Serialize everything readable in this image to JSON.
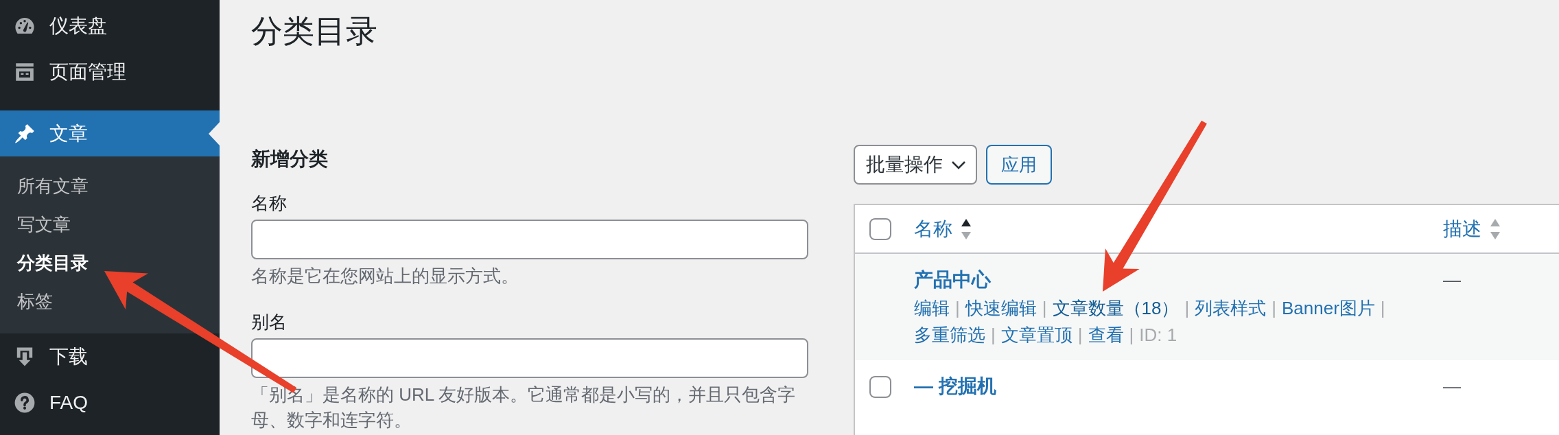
{
  "sidebar": {
    "menu": [
      {
        "kind": "item",
        "label": "仪表盘",
        "selected": false
      },
      {
        "kind": "item",
        "label": "页面管理",
        "selected": false
      },
      {
        "kind": "separator"
      },
      {
        "kind": "item",
        "label": "文章",
        "selected": true,
        "children": [
          {
            "label": "所有文章",
            "selected": false
          },
          {
            "label": "写文章",
            "selected": false
          },
          {
            "label": "分类目录",
            "selected": true
          },
          {
            "label": "标签",
            "selected": false
          }
        ]
      },
      {
        "kind": "item",
        "label": "下载",
        "selected": false
      },
      {
        "kind": "item",
        "label": "FAQ",
        "selected": false
      }
    ]
  },
  "page": {
    "title": "分类目录"
  },
  "add_form": {
    "heading": "新增分类",
    "fields": [
      {
        "label": "名称",
        "hint": "名称是它在您网站上的显示方式。"
      },
      {
        "label": "别名",
        "hint": "「别名」是名称的 URL 友好版本。它通常都是小写的，并且只包含字母、数字和连字符。"
      }
    ]
  },
  "list": {
    "bulk_actions": {
      "value": "批量操作"
    },
    "apply_button": "应用",
    "table": {
      "select_all": {
        "checked": false
      },
      "columns": [
        {
          "label": "名称",
          "sorted": true
        },
        {
          "label": "描述",
          "sorted": false
        }
      ],
      "rows": [
        {
          "name": "产品中心",
          "description": "—",
          "actions": [
            {
              "label": "编辑",
              "kind": "link",
              "hovered": false,
              "separator": "|"
            },
            {
              "label": "快速编辑",
              "kind": "link",
              "hovered": false,
              "separator": "|"
            },
            {
              "label": "文章数量（18）",
              "kind": "link",
              "hovered": true,
              "separator": "|"
            },
            {
              "label": "列表样式",
              "kind": "link",
              "hovered": false,
              "separator": "|"
            },
            {
              "label": "Banner图片",
              "kind": "link",
              "hovered": false,
              "separator": "|"
            },
            {
              "label": "多重筛选",
              "kind": "link",
              "hovered": false,
              "separator": "|"
            },
            {
              "label": "文章置顶",
              "kind": "link",
              "hovered": false,
              "separator": "|"
            },
            {
              "label": "查看",
              "kind": "link",
              "hovered": false,
              "separator": "|"
            },
            {
              "label": "ID: 1",
              "kind": "text"
            }
          ],
          "children": [
            {
              "name": "— 挖掘机",
              "checked": false,
              "description": "—"
            }
          ]
        }
      ]
    }
  }
}
